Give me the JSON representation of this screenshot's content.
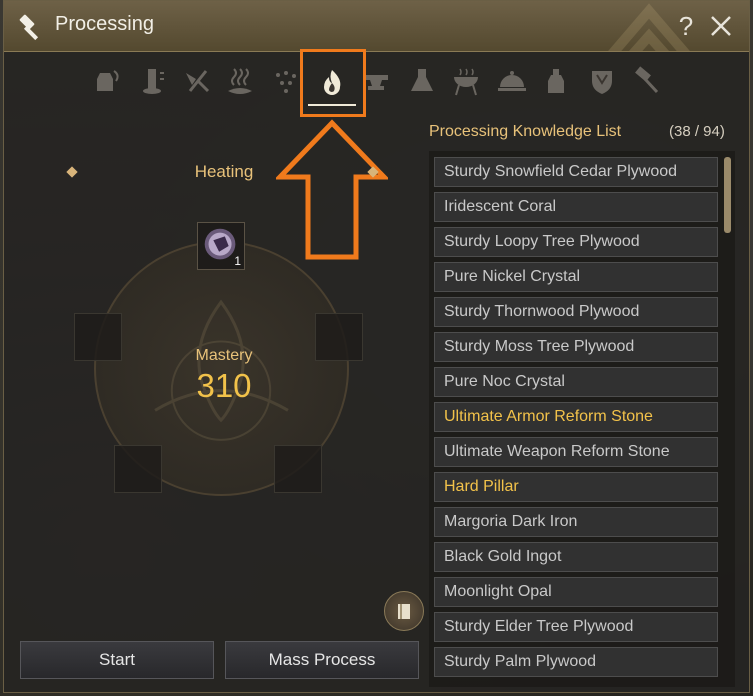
{
  "window": {
    "title": "Processing",
    "help_label": "?"
  },
  "tabs": [
    {
      "name": "shaking",
      "icon": "shaking-icon"
    },
    {
      "name": "grinding",
      "icon": "grinding-icon"
    },
    {
      "name": "chopping",
      "icon": "chopping-icon"
    },
    {
      "name": "drying",
      "icon": "drying-icon"
    },
    {
      "name": "filtering",
      "icon": "filtering-icon"
    },
    {
      "name": "heating",
      "icon": "flame-icon",
      "active": true
    },
    {
      "name": "smithing",
      "icon": "anvil-icon"
    },
    {
      "name": "alchemy",
      "icon": "flask-icon"
    },
    {
      "name": "cooking",
      "icon": "grill-icon"
    },
    {
      "name": "imperial-cooking",
      "icon": "cloche-icon"
    },
    {
      "name": "imperial-alchemy",
      "icon": "potion-icon"
    },
    {
      "name": "guild",
      "icon": "shield-icon"
    },
    {
      "name": "repair",
      "icon": "hammer-icon"
    }
  ],
  "processing": {
    "category": "Heating",
    "material_qty": "1",
    "mastery_label": "Mastery",
    "mastery_value": "310"
  },
  "buttons": {
    "start": "Start",
    "mass_process": "Mass Process"
  },
  "knowledge": {
    "title": "Processing Knowledge List",
    "count": "(38 / 94)",
    "items": [
      {
        "label": "Sturdy Snowfield Cedar Plywood",
        "highlight": false
      },
      {
        "label": "Iridescent Coral",
        "highlight": false
      },
      {
        "label": "Sturdy Loopy Tree Plywood",
        "highlight": false
      },
      {
        "label": "Pure Nickel Crystal",
        "highlight": false
      },
      {
        "label": "Sturdy Thornwood Plywood",
        "highlight": false
      },
      {
        "label": "Sturdy Moss Tree Plywood",
        "highlight": false
      },
      {
        "label": "Pure Noc Crystal",
        "highlight": false
      },
      {
        "label": "Ultimate Armor Reform Stone",
        "highlight": true
      },
      {
        "label": "Ultimate Weapon Reform Stone",
        "highlight": false
      },
      {
        "label": "Hard Pillar",
        "highlight": true
      },
      {
        "label": "Margoria Dark Iron",
        "highlight": false
      },
      {
        "label": "Black Gold Ingot",
        "highlight": false
      },
      {
        "label": "Moonlight Opal",
        "highlight": false
      },
      {
        "label": "Sturdy Elder Tree Plywood",
        "highlight": false
      },
      {
        "label": "Sturdy Palm Plywood",
        "highlight": false
      }
    ]
  },
  "colors": {
    "accent": "#f07a1c",
    "gold": "#f2c24a",
    "label": "#e8c27a"
  }
}
